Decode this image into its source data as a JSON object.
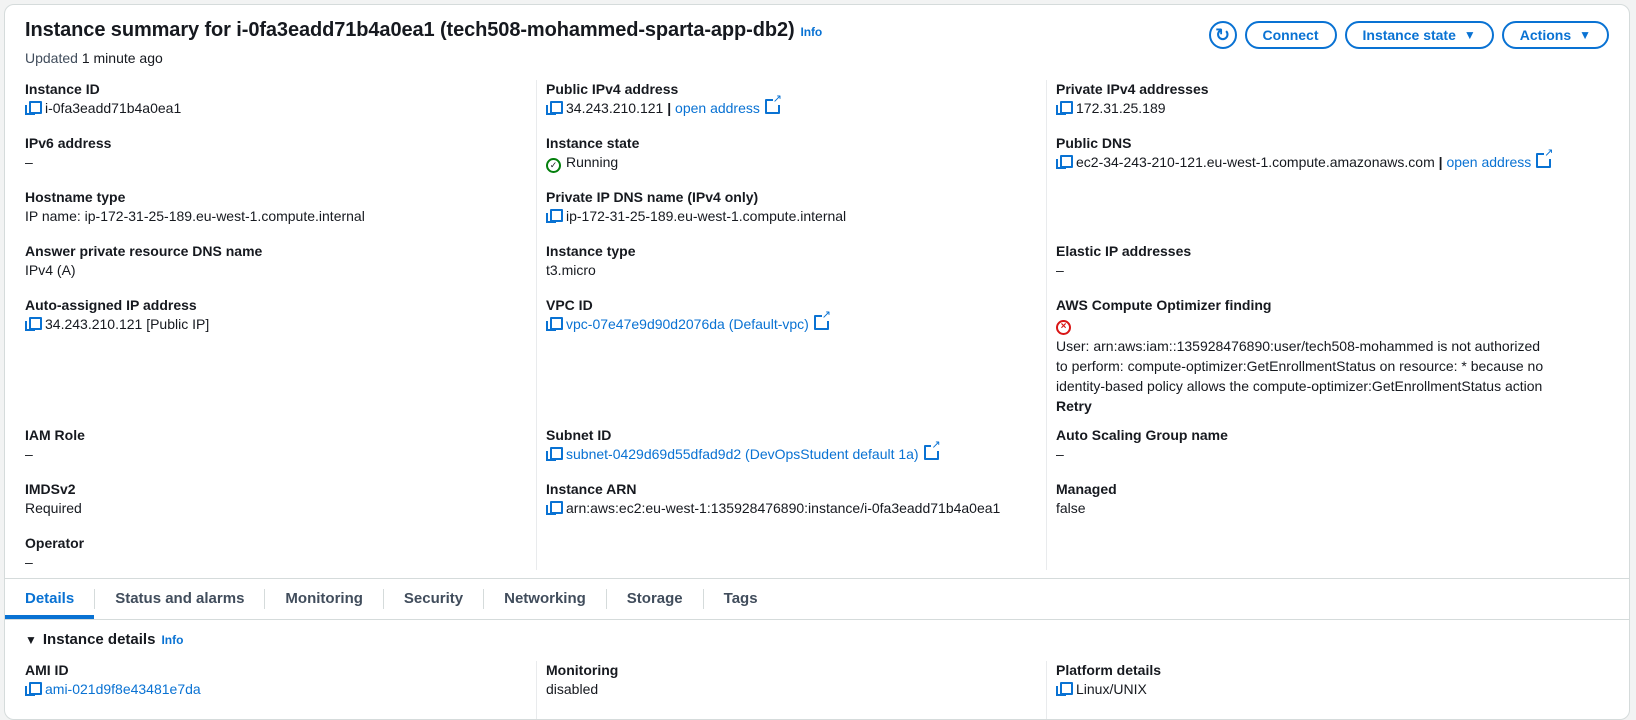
{
  "header": {
    "title": "Instance summary for i-0fa3eadd71b4a0ea1 (tech508-mohammed-sparta-app-db2)",
    "info": "Info",
    "updated_prefix": "Updated",
    "updated_time": "1 minute ago",
    "buttons": {
      "connect": "Connect",
      "instance_state": "Instance state",
      "actions": "Actions"
    }
  },
  "fields": {
    "instance_id": {
      "label": "Instance ID",
      "value": "i-0fa3eadd71b4a0ea1"
    },
    "ipv6": {
      "label": "IPv6 address",
      "value": "–"
    },
    "hostname_type": {
      "label": "Hostname type",
      "value": "IP name: ip-172-31-25-189.eu-west-1.compute.internal"
    },
    "answer_dns": {
      "label": "Answer private resource DNS name",
      "value": "IPv4 (A)"
    },
    "auto_ip": {
      "label": "Auto-assigned IP address",
      "value": "34.243.210.121 [Public IP]"
    },
    "iam_role": {
      "label": "IAM Role",
      "value": "–"
    },
    "imdsv2": {
      "label": "IMDSv2",
      "value": "Required"
    },
    "operator": {
      "label": "Operator",
      "value": "–"
    },
    "public_ipv4": {
      "label": "Public IPv4 address",
      "value": "34.243.210.121",
      "sep": "|",
      "link": "open address"
    },
    "instance_state": {
      "label": "Instance state",
      "value": "Running"
    },
    "private_dns": {
      "label": "Private IP DNS name (IPv4 only)",
      "value": "ip-172-31-25-189.eu-west-1.compute.internal"
    },
    "instance_type": {
      "label": "Instance type",
      "value": "t3.micro"
    },
    "vpc_id": {
      "label": "VPC ID",
      "value": "vpc-07e47e9d90d2076da (Default-vpc)"
    },
    "subnet_id": {
      "label": "Subnet ID",
      "value": "subnet-0429d69d55dfad9d2 (DevOpsStudent default 1a)"
    },
    "instance_arn": {
      "label": "Instance ARN",
      "value": "arn:aws:ec2:eu-west-1:135928476890:instance/i-0fa3eadd71b4a0ea1"
    },
    "private_ipv4": {
      "label": "Private IPv4 addresses",
      "value": "172.31.25.189"
    },
    "public_dns": {
      "label": "Public DNS",
      "value": "ec2-34-243-210-121.eu-west-1.compute.amazonaws.com",
      "sep": "|",
      "link": "open address"
    },
    "elastic_ip": {
      "label": "Elastic IP addresses",
      "value": "–"
    },
    "optimizer": {
      "label": "AWS Compute Optimizer finding",
      "message": "User: arn:aws:iam::135928476890:user/tech508-mohammed is not authorized to perform: compute-optimizer:GetEnrollmentStatus on resource: * because no identity-based policy allows the compute-optimizer:GetEnrollmentStatus action",
      "retry": "Retry"
    },
    "asg_name": {
      "label": "Auto Scaling Group name",
      "value": "–"
    },
    "managed": {
      "label": "Managed",
      "value": "false"
    }
  },
  "tabs": [
    "Details",
    "Status and alarms",
    "Monitoring",
    "Security",
    "Networking",
    "Storage",
    "Tags"
  ],
  "details": {
    "title": "Instance details",
    "info": "Info",
    "ami_id": {
      "label": "AMI ID",
      "value": "ami-021d9f8e43481e7da"
    },
    "monitoring": {
      "label": "Monitoring",
      "value": "disabled"
    },
    "platform": {
      "label": "Platform details",
      "value": "Linux/UNIX"
    }
  },
  "colors": {
    "link": "#0972d3",
    "running": "#037f0c",
    "error": "#d91515"
  }
}
